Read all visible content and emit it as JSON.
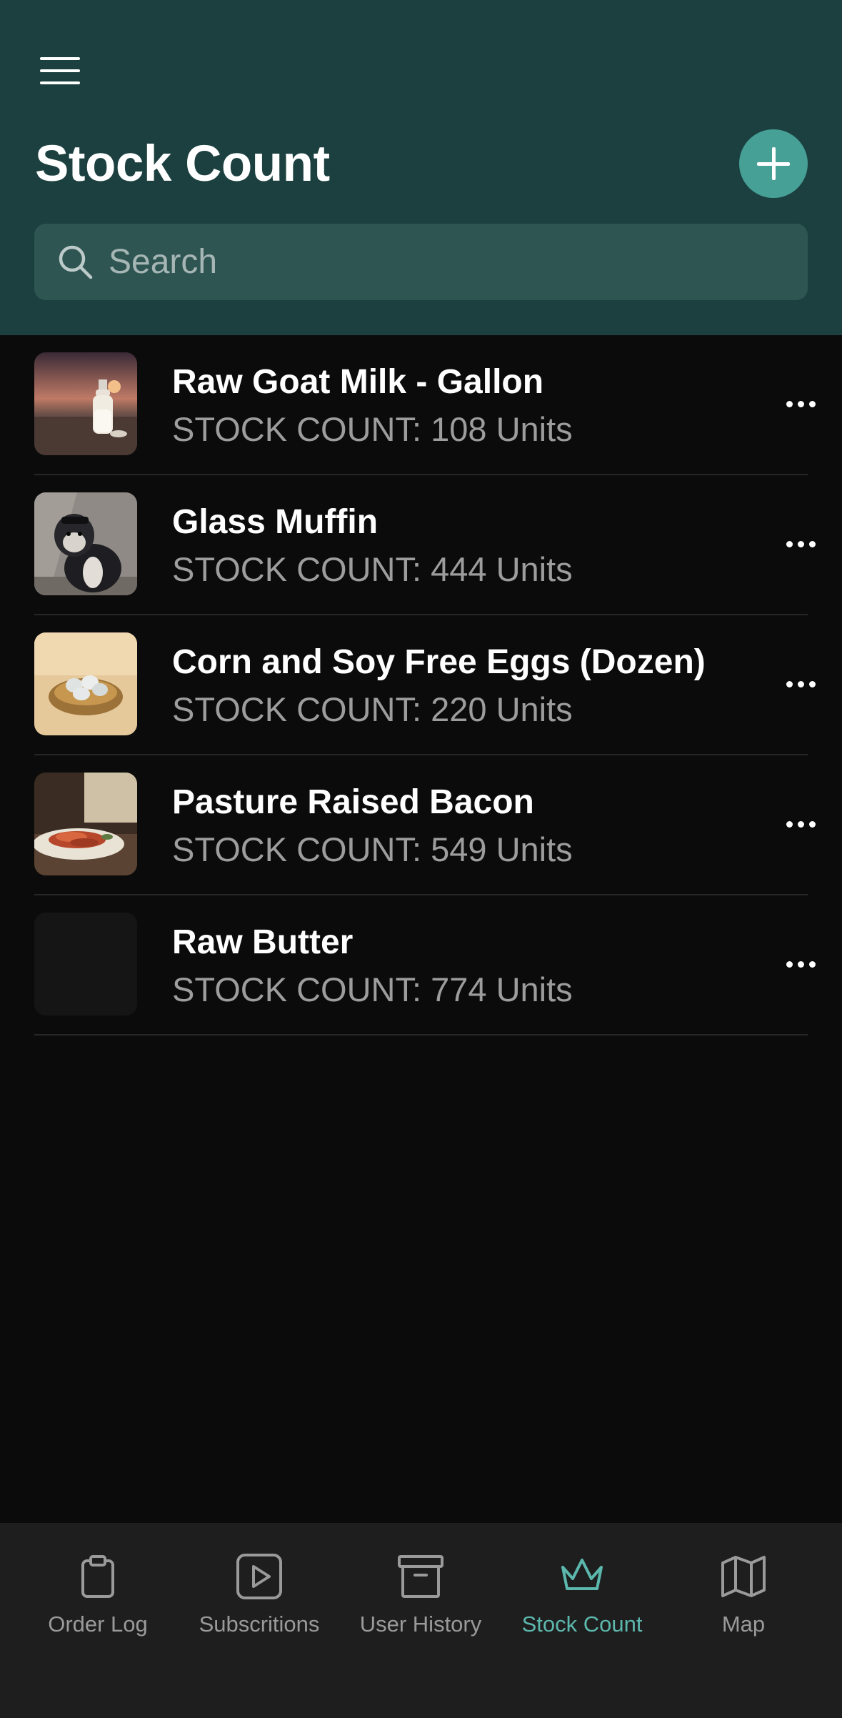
{
  "header": {
    "title": "Stock Count",
    "menu_icon": "hamburger-menu-icon",
    "add_icon": "plus-icon",
    "background": "#1c4040",
    "accent": "#46a096"
  },
  "search": {
    "placeholder": "Search",
    "value": "",
    "icon": "search-icon"
  },
  "items": [
    {
      "name": "Raw Goat Milk - Gallon",
      "stock": "STOCK COUNT: 108 Units",
      "thumb": "goat-milk-bottle"
    },
    {
      "name": "Glass Muffin",
      "stock": "STOCK COUNT: 444 Units",
      "thumb": "dog-photo"
    },
    {
      "name": "Corn and Soy Free Eggs (Dozen)",
      "stock": "STOCK COUNT: 220 Units",
      "thumb": "eggs-in-nest"
    },
    {
      "name": "Pasture Raised Bacon",
      "stock": "STOCK COUNT: 549 Units",
      "thumb": "bacon-plate"
    },
    {
      "name": "Raw Butter",
      "stock": "STOCK COUNT: 774 Units",
      "thumb": "empty"
    }
  ],
  "tabs": [
    {
      "label": "Order Log",
      "icon": "clipboard-icon",
      "active": false
    },
    {
      "label": "Subscritions",
      "icon": "play-icon",
      "active": false
    },
    {
      "label": "User History",
      "icon": "archive-box-icon",
      "active": false
    },
    {
      "label": "Stock Count",
      "icon": "crown-icon",
      "active": true
    },
    {
      "label": "Map",
      "icon": "map-icon",
      "active": false
    }
  ],
  "colors": {
    "tab_active": "#5cb8ad",
    "tab_inactive": "#9a9a9a"
  }
}
